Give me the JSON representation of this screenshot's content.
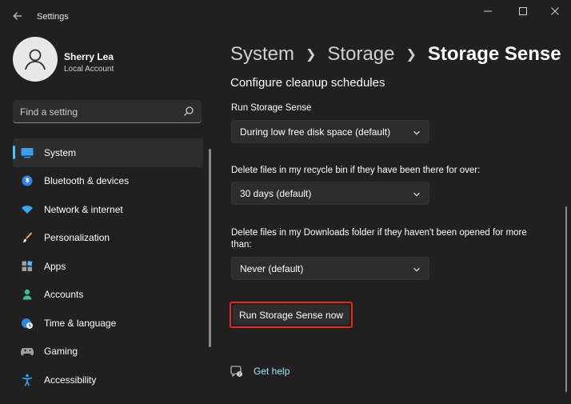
{
  "window": {
    "title": "Settings"
  },
  "profile": {
    "name": "Sherry Lea",
    "account_type": "Local Account"
  },
  "search": {
    "placeholder": "Find a setting"
  },
  "sidebar": {
    "items": [
      {
        "label": "System",
        "icon": "system-icon",
        "active": true
      },
      {
        "label": "Bluetooth & devices",
        "icon": "bluetooth-icon"
      },
      {
        "label": "Network & internet",
        "icon": "wifi-icon"
      },
      {
        "label": "Personalization",
        "icon": "brush-icon"
      },
      {
        "label": "Apps",
        "icon": "apps-icon"
      },
      {
        "label": "Accounts",
        "icon": "accounts-icon"
      },
      {
        "label": "Time & language",
        "icon": "globe-clock-icon"
      },
      {
        "label": "Gaming",
        "icon": "gamepad-icon"
      },
      {
        "label": "Accessibility",
        "icon": "accessibility-icon"
      }
    ]
  },
  "breadcrumb": {
    "items": [
      "System",
      "Storage",
      "Storage Sense"
    ]
  },
  "main": {
    "section_heading": "Configure cleanup schedules",
    "run_label": "Run Storage Sense",
    "run_value": "During low free disk space (default)",
    "recycle_label": "Delete files in my recycle bin if they have been there for over:",
    "recycle_value": "30 days (default)",
    "downloads_label": "Delete files in my Downloads folder if they haven't been opened for more than:",
    "downloads_value": "Never (default)",
    "run_now_button": "Run Storage Sense now",
    "help_link": "Get help"
  },
  "colors": {
    "background": "#202020",
    "accent": "#4cc2ff",
    "highlight_border": "#e02a20",
    "link": "#99ebff"
  }
}
